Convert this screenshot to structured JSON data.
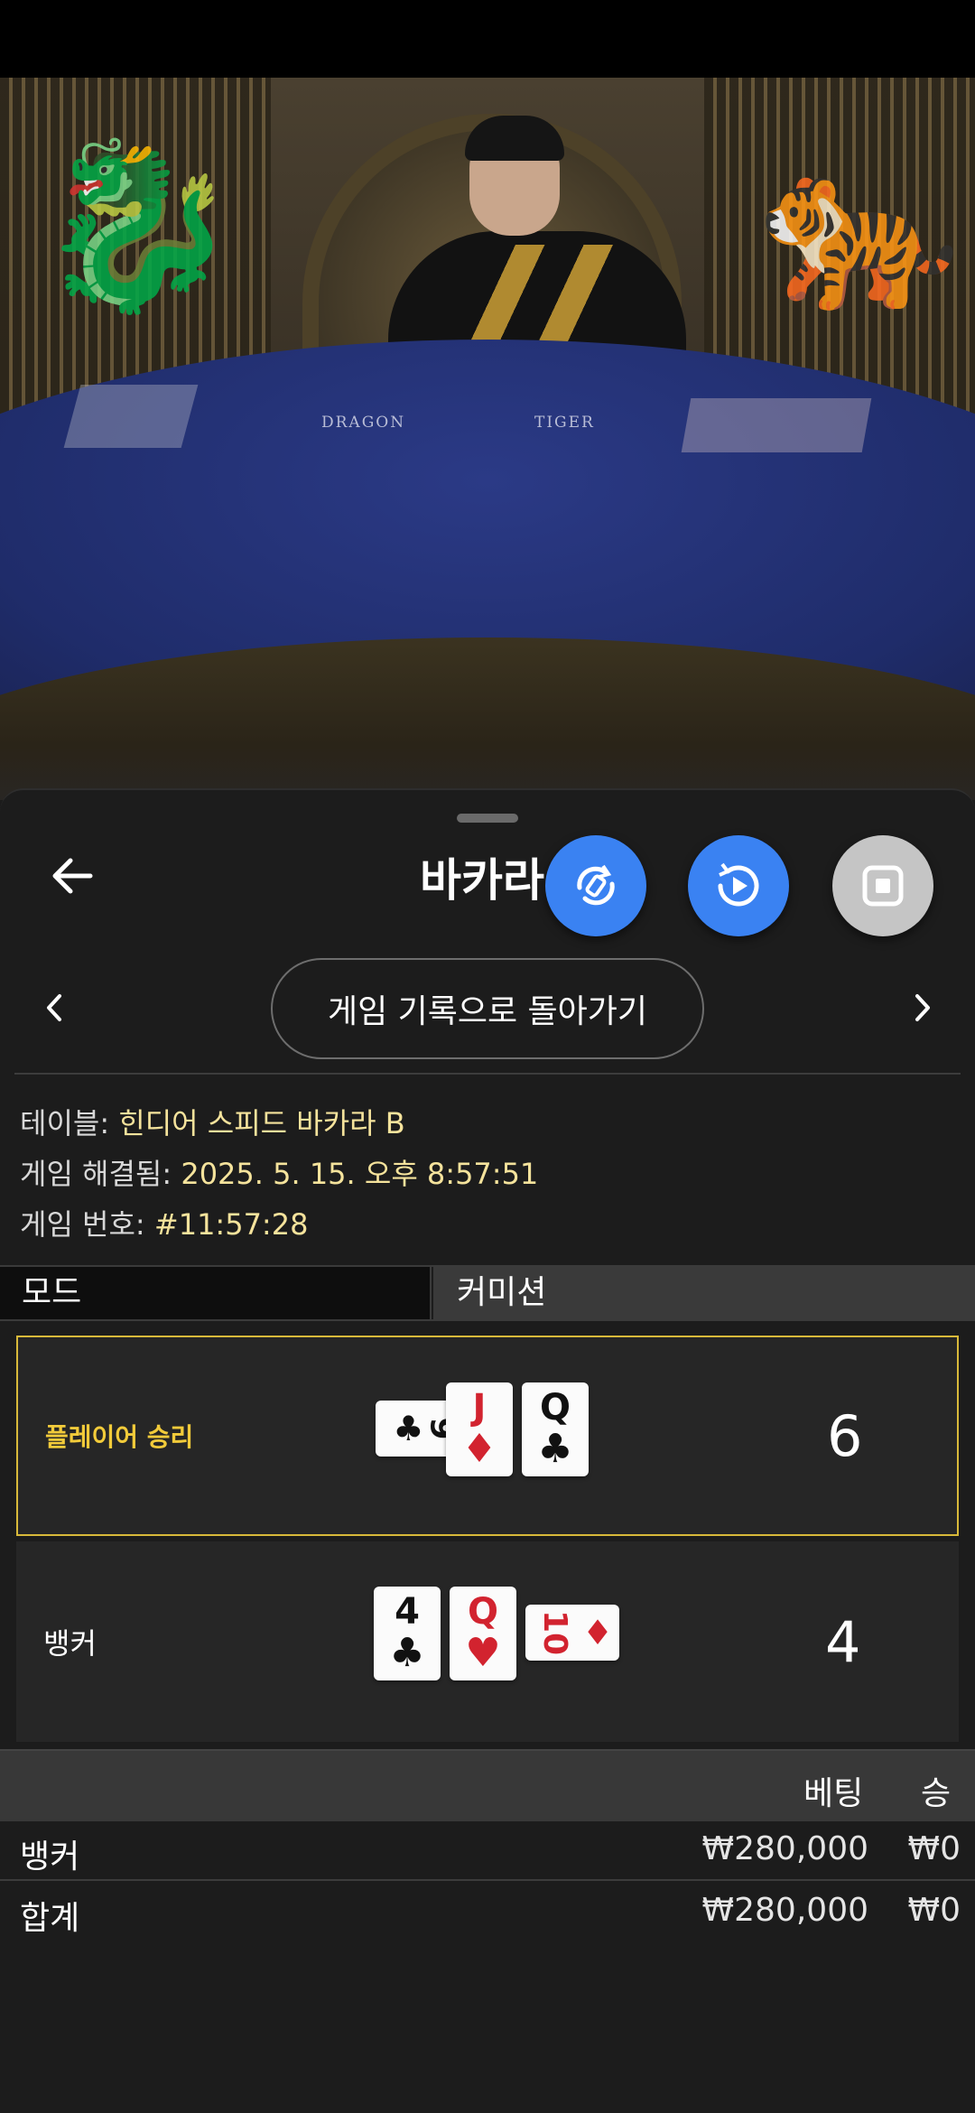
{
  "video": {
    "table_labels": [
      "DRAGON",
      "TIGER"
    ]
  },
  "sheet": {
    "title": "바카라",
    "history_button": "게임 기록으로 돌아가기",
    "info": {
      "table_label": "테이블: ",
      "table_value": "힌디어 스피드 바카라 B",
      "resolved_label": "게임 해결됨: ",
      "resolved_value": "2025. 5. 15. 오후 8:57:51",
      "number_label": "게임 번호: ",
      "number_value": "#11:57:28"
    },
    "tabs": {
      "mode": "모드",
      "commission": "커미션"
    },
    "results": [
      {
        "label": "플레이어 승리",
        "cards": [
          {
            "rank": "9",
            "suit": "♣",
            "color": "#111111"
          },
          {
            "rank": "J",
            "suit": "♦",
            "color": "#d2232f"
          },
          {
            "rank": "Q",
            "suit": "♣",
            "color": "#111111"
          }
        ],
        "score": "6"
      },
      {
        "label": "뱅커",
        "cards": [
          {
            "rank": "4",
            "suit": "♣",
            "color": "#111111"
          },
          {
            "rank": "Q",
            "suit": "♥",
            "color": "#d2232f"
          },
          {
            "rank": "10",
            "suit": "♦",
            "color": "#d2232f"
          }
        ],
        "score": "4"
      }
    ],
    "bets": {
      "header_bet": "베팅",
      "header_win": "승",
      "rows": [
        {
          "name": "뱅커",
          "amount": "₩280,000",
          "win": "₩0"
        },
        {
          "name": "합계",
          "amount": "₩280,000",
          "win": "₩0"
        }
      ]
    }
  },
  "colors": {
    "accent_blue": "#3a82f2",
    "highlight_gold": "#d8b93a",
    "value_yellow": "#f5e39c"
  }
}
